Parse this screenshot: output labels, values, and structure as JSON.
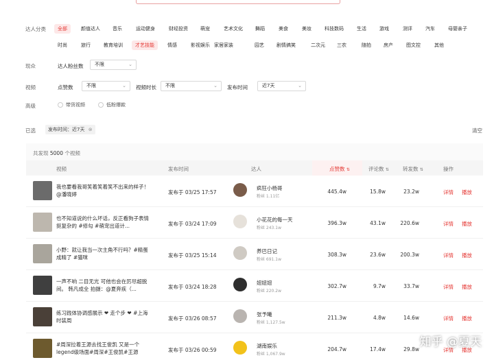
{
  "filters": {
    "category_label": "达人分类",
    "categories_row1": [
      "全部",
      "颜值达人",
      "音乐",
      "运动健身",
      "财经投资",
      "萌宠",
      "艺术文化",
      "舞蹈",
      "美食",
      "美妆",
      "科技数码",
      "生活",
      "游戏",
      "测评",
      "汽车",
      "母婴亲子"
    ],
    "categories_row2": [
      "时尚",
      "旅行",
      "教育培训",
      "才艺技能",
      "情感",
      "影视娱乐",
      "家居家装",
      "园艺",
      "剧情搞笑",
      "二次元",
      "三农",
      "随拍",
      "房产",
      "图文控",
      "其他"
    ],
    "active_category": "全部",
    "highlight_category": "才艺技能",
    "creator_label": "现众",
    "fans_label": "达人粉丝数",
    "fans_value": "不限",
    "video_label": "视频",
    "likes_label": "点赞数",
    "likes_value": "不限",
    "duration_label": "视频时长",
    "duration_value": "不限",
    "pubtime_label": "发布时间",
    "pubtime_value": "近7天",
    "advanced_label": "高级",
    "adv_option1": "带货视频",
    "adv_option2": "低粉爆款",
    "selected_label": "已选",
    "selected_chip": "发布时间：近7天",
    "clear_label": "清空"
  },
  "summary": {
    "prefix": "共发现",
    "count": "5000",
    "suffix": "个视频"
  },
  "table": {
    "headers": {
      "video": "视频",
      "pubtime": "发布时间",
      "author": "达人",
      "likes": "点赞数",
      "comments": "评论数",
      "shares": "转发数",
      "ops": "操作"
    },
    "rows": [
      {
        "title": "我也要看我哥笑着笑着笑不出来的样子！@潘晓婷",
        "pubtime": "发布于 03/25 17:57",
        "author": "疯狂小杨哥",
        "fans": "粉丝 1.11亿",
        "likes": "445.4w",
        "comments": "15.8w",
        "shares": "23.2w",
        "thumb_color": "#6b6b6b",
        "avatar_color": "#7a5c4a"
      },
      {
        "title": "也不知道说的什么坏话，反正看狗子表情挺复杂的 #修勾 #萌宠出道计...",
        "pubtime": "发布于 03/24 17:09",
        "author": "小花花的每一天",
        "fans": "粉丝 243.1w",
        "likes": "396.3w",
        "comments": "43.1w",
        "shares": "220.6w",
        "thumb_color": "#bdb7ae",
        "avatar_color": "#e6e1da"
      },
      {
        "title": "小野：就让我当一次主角不行吗？#精蛋成精了 #猫咪",
        "pubtime": "发布于 03/25 15:14",
        "author": "养巴日记",
        "fans": "粉丝 691.1w",
        "likes": "308.3w",
        "comments": "23.6w",
        "shares": "200.3w",
        "thumb_color": "#a9a59c",
        "avatar_color": "#cfcac3"
      },
      {
        "title": "一声不响 二目无光 可他也会在厉尽超脱间。 韩凡成全 拍摄：@夏奔疾（...",
        "pubtime": "发布于 03/24 18:28",
        "author": "妞妞妞",
        "fans": "粉丝 220.2w",
        "likes": "302.7w",
        "comments": "9.7w",
        "shares": "33.7w",
        "thumb_color": "#3f3f3f",
        "avatar_color": "#2e2e2e"
      },
      {
        "title": "练习践体协调感展示 ❤ 走个步 ❤ #上海时装周",
        "pubtime": "发布于 03/26 08:57",
        "author": "张予曦",
        "fans": "粉丝 1,127.5w",
        "likes": "211.3w",
        "comments": "4.8w",
        "shares": "14.6w",
        "thumb_color": "#4a4038",
        "avatar_color": "#b9b4b0"
      },
      {
        "title": "#周深拉着王源去找王俊凯 又是一个legend级场面#周深#王俊凯#王源",
        "pubtime": "发布于 03/26 00:59",
        "author": "湖南娱乐",
        "fans": "粉丝 1,067.9w",
        "likes": "204.7w",
        "comments": "17.4w",
        "shares": "29.8w",
        "thumb_color": "#6d5a2e",
        "avatar_color": "#f2c21b"
      }
    ],
    "op_detail": "详情",
    "op_play": "播放"
  },
  "watermark": "知乎 @夏天",
  "colors": {
    "accent": "#e53935",
    "accent_bg": "#fde8e8"
  }
}
